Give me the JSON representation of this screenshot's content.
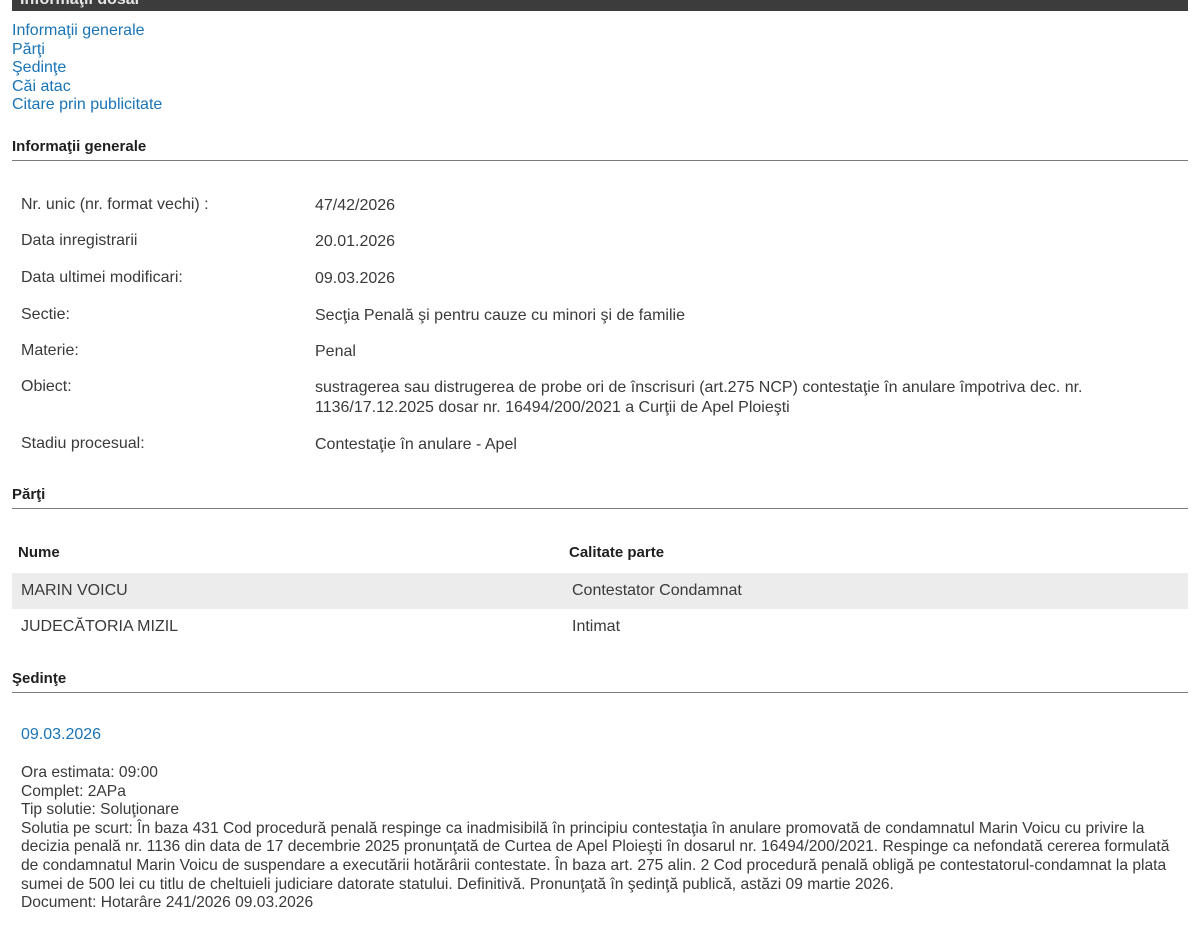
{
  "header": {
    "title": "Informaţii dosar"
  },
  "nav": {
    "links": [
      "Informaţii generale",
      "Părţi",
      "Şedinţe",
      "Căi atac",
      "Citare prin publicitate"
    ]
  },
  "general": {
    "title": "Informaţii generale",
    "rows": [
      {
        "label": "Nr. unic (nr. format vechi) :",
        "value": "47/42/2026"
      },
      {
        "label": "Data inregistrarii",
        "value": "20.01.2026"
      },
      {
        "label": "Data ultimei modificari:",
        "value": "09.03.2026"
      },
      {
        "label": "Sectie:",
        "value": "Secţia Penală şi pentru cauze cu minori şi de familie"
      },
      {
        "label": "Materie:",
        "value": "Penal"
      },
      {
        "label": "Obiect:",
        "value": "sustragerea sau distrugerea de probe ori de înscrisuri (art.275 NCP) contestaţie în anulare împotriva dec. nr. 1136/17.12.2025 dosar nr. 16494/200/2021 a Curţii de Apel Ploieşti"
      },
      {
        "label": "Stadiu procesual:",
        "value": "Contestaţie în anulare - Apel"
      }
    ]
  },
  "parties": {
    "title": "Părţi",
    "headers": {
      "name": "Nume",
      "role": "Calitate parte"
    },
    "rows": [
      {
        "name": "MARIN VOICU",
        "role": "Contestator Condamnat"
      },
      {
        "name": "JUDECĂTORIA MIZIL",
        "role": "Intimat"
      }
    ]
  },
  "hearings": {
    "title": "Şedinţe",
    "items": [
      {
        "date": "09.03.2026",
        "ora": "Ora estimata: 09:00",
        "complet": "Complet: 2APa",
        "tip": "Tip solutie: Soluţionare",
        "solutie": "Solutia pe scurt: În baza 431 Cod procedură penală respinge ca inadmisibilă în principiu contestaţia în anulare promovată de condamnatul Marin Voicu cu privire la decizia penală nr. 1136 din data de 17 decembrie 2025 pronunţată de Curtea de Apel Ploieşti în dosarul nr. 16494/200/2021. Respinge ca nefondată cererea formulată de condamnatul Marin Voicu de suspendare a executării hotărârii contestate. În baza art. 275 alin. 2 Cod procedură penală obligă pe contestatorul-condamnat la plata sumei de 500 lei cu titlu de cheltuieli judiciare datorate statului. Definitivă. Pronunţată în şedinţă publică, astăzi 09 martie 2026.",
        "document": "Document: Hotarâre  241/2026  09.03.2026"
      }
    ]
  },
  "colors": {
    "link": "#1a74b5",
    "header_bg": "#3c3c3c",
    "row_shade": "#ececec",
    "rule": "#7b7b7b"
  }
}
